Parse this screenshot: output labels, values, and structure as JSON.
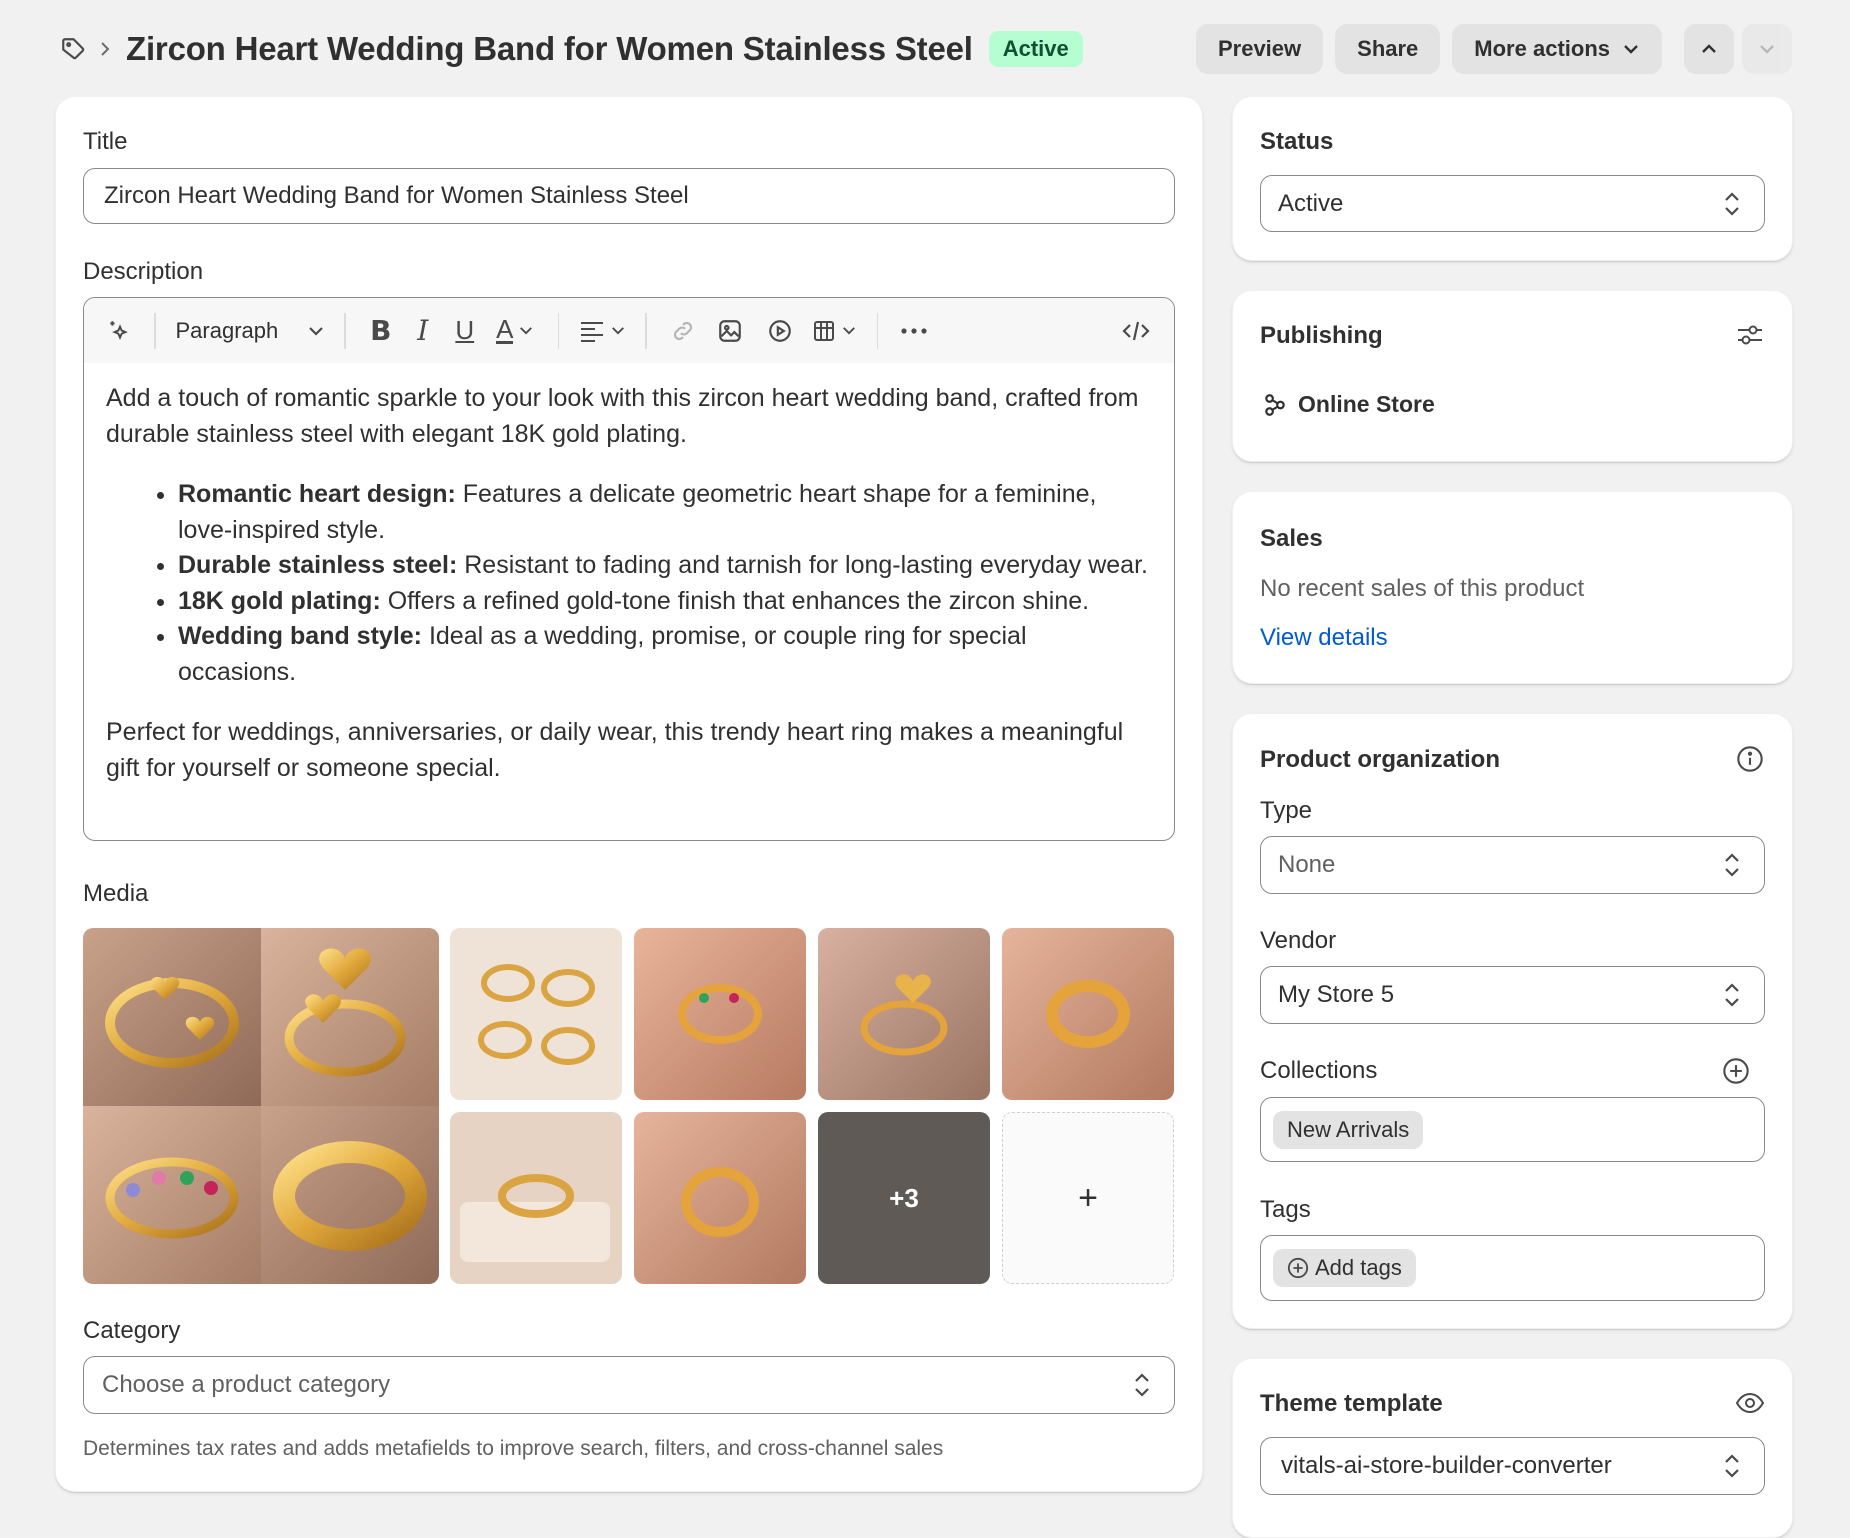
{
  "header": {
    "breadcrumb_icon": "tag-icon",
    "title": "Zircon Heart Wedding Band for Women Stainless Steel",
    "status_badge": "Active",
    "actions": {
      "preview": "Preview",
      "share": "Share",
      "more": "More actions"
    }
  },
  "main": {
    "title_label": "Title",
    "title_value": "Zircon Heart Wedding Band for Women Stainless Steel",
    "description_label": "Description",
    "toolbar": {
      "paragraph": "Paragraph"
    },
    "description": {
      "intro": "Add a touch of romantic sparkle to your look with this zircon heart wedding band, crafted from durable stainless steel with elegant 18K gold plating.",
      "bullets": [
        {
          "bold": "Romantic heart design:",
          "text": " Features a delicate geometric heart shape for a feminine, love-inspired style."
        },
        {
          "bold": "Durable stainless steel:",
          "text": " Resistant to fading and tarnish for long-lasting everyday wear."
        },
        {
          "bold": "18K gold plating:",
          "text": " Offers a refined gold-tone finish that enhances the zircon shine."
        },
        {
          "bold": "Wedding band style:",
          "text": " Ideal as a wedding, promise, or couple ring for special occasions."
        }
      ],
      "outro": "Perfect for weddings, anniversaries, or daily wear, this trendy heart ring makes a meaningful gift for yourself or someone special."
    },
    "media_label": "Media",
    "media_more": "+3",
    "media_add": "+",
    "category_label": "Category",
    "category_placeholder": "Choose a product category",
    "category_help": "Determines tax rates and adds metafields to improve search, filters, and cross-channel sales"
  },
  "sidebar": {
    "status": {
      "title": "Status",
      "value": "Active"
    },
    "publishing": {
      "title": "Publishing",
      "channel": "Online Store"
    },
    "sales": {
      "title": "Sales",
      "text": "No recent sales of this product",
      "link": "View details"
    },
    "organization": {
      "title": "Product organization",
      "type_label": "Type",
      "type_value": "None",
      "vendor_label": "Vendor",
      "vendor_value": "My Store 5",
      "collections_label": "Collections",
      "collection_chip": "New Arrivals",
      "tags_label": "Tags",
      "tags_add": "Add tags"
    },
    "theme": {
      "title": "Theme template",
      "value": "vitals-ai-store-builder-converter"
    }
  },
  "colors": {
    "active_badge_bg": "#b4fed2",
    "active_badge_text": "#0c5132",
    "link": "#005bd3"
  }
}
